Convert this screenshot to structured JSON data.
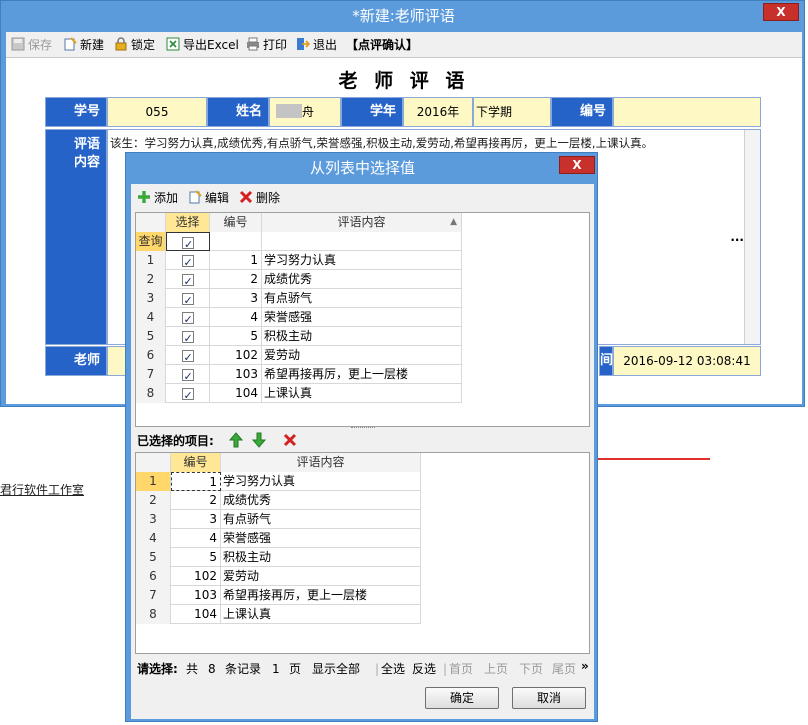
{
  "main": {
    "title": "*新建:老师评语",
    "close": "X",
    "toolbar": {
      "save": "保存",
      "new": "新建",
      "lock": "锁定",
      "export": "导出Excel",
      "print": "打印",
      "exit": "退出",
      "confirm": "【点评确认】"
    },
    "form_title": "老 师 评 语",
    "student_id_label": "学号",
    "student_id": "055",
    "name_label": "姓名",
    "name_value": "舟",
    "year_label": "学年",
    "year_value": "2016年",
    "term_value": "下学期",
    "number_label": "编号",
    "number_value": "",
    "comment_label": "评语内容",
    "comment_text": "该生：学习努力认真,成绩优秀,有点骄气,荣誉感强,积极主动,爱劳动,希望再接再厉，更上一层楼,上课认真。",
    "more_button": "...",
    "teacher_label": "老师",
    "time_label_tail": "间",
    "time_value": "2016-09-12 03:08:41"
  },
  "background": {
    "studio_text": "君行软件工作室"
  },
  "dialog": {
    "title": "从列表中选择值",
    "close": "X",
    "toolbar": {
      "add": "添加",
      "edit": "编辑",
      "delete": "删除"
    },
    "top_grid": {
      "headers": [
        "选择",
        "编号",
        "评语内容"
      ],
      "query_label": "查询",
      "rows": [
        {
          "n": "1",
          "id": "1",
          "text": "学习努力认真"
        },
        {
          "n": "2",
          "id": "2",
          "text": "成绩优秀"
        },
        {
          "n": "3",
          "id": "3",
          "text": "有点骄气"
        },
        {
          "n": "4",
          "id": "4",
          "text": "荣誉感强"
        },
        {
          "n": "5",
          "id": "5",
          "text": "积极主动"
        },
        {
          "n": "6",
          "id": "102",
          "text": "爱劳动"
        },
        {
          "n": "7",
          "id": "103",
          "text": "希望再接再厉，更上一层楼"
        },
        {
          "n": "8",
          "id": "104",
          "text": "上课认真"
        }
      ]
    },
    "selected_label": "已选择的项目:",
    "bottom_grid": {
      "headers": [
        "编号",
        "评语内容"
      ],
      "rows": [
        {
          "n": "1",
          "id": "1",
          "text": "学习努力认真"
        },
        {
          "n": "2",
          "id": "2",
          "text": "成绩优秀"
        },
        {
          "n": "3",
          "id": "3",
          "text": "有点骄气"
        },
        {
          "n": "4",
          "id": "4",
          "text": "荣誉感强"
        },
        {
          "n": "5",
          "id": "5",
          "text": "积极主动"
        },
        {
          "n": "6",
          "id": "102",
          "text": "爱劳动"
        },
        {
          "n": "7",
          "id": "103",
          "text": "希望再接再厉，更上一层楼"
        },
        {
          "n": "8",
          "id": "104",
          "text": "上课认真"
        }
      ]
    },
    "pager": {
      "prompt": "请选择:",
      "total_prefix": "共",
      "total": "8",
      "records": "条记录",
      "page": "1",
      "page_unit": "页",
      "show_all": "显示全部",
      "select_all": "全选",
      "invert": "反选",
      "first": "首页",
      "prev": "上页",
      "next": "下页",
      "last": "尾页",
      "more": "»"
    },
    "ok": "确定",
    "cancel": "取消"
  },
  "colors": {
    "window_blue": "#5b9bdc",
    "label_blue": "#2563c9",
    "value_yellow": "#fdf8c4",
    "delete_red": "#d42020",
    "arrow_green": "#3aa83a"
  }
}
